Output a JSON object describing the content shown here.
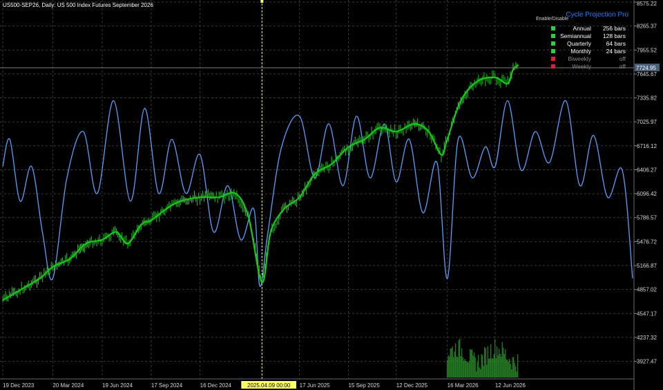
{
  "title": "US500-SEP26, Daily:  US 500 Index Futures September 2026",
  "panel": {
    "title": "Cycle Projection Pro",
    "subtitle": "Enable/Disable",
    "rows": [
      {
        "name": "Annual",
        "value": "256 bars",
        "enabled": true
      },
      {
        "name": "Semiannual",
        "value": "128 bars",
        "enabled": true
      },
      {
        "name": "Quarterly",
        "value": "64 bars",
        "enabled": true
      },
      {
        "name": "Monthly",
        "value": "24 bars",
        "enabled": true
      },
      {
        "name": "Biweekly",
        "value": "off",
        "enabled": false
      },
      {
        "name": "Weekly",
        "value": "off",
        "enabled": false
      }
    ]
  },
  "colors": {
    "background": "#000000",
    "price": "#19c819",
    "cycle": "#5aa0ff",
    "grid": "#3a3a3a",
    "marker": "#ffff66",
    "enabled": "#2ecc40",
    "disabled": "#d6204a",
    "current_price_bg": "#4a5f7a"
  },
  "chart_data": {
    "type": "line",
    "ylim": [
      3700,
      8575.22
    ],
    "y_ticks": [
      "8575.22",
      "8265.37",
      "7955.52",
      "7645.67",
      "7335.82",
      "7025.97",
      "6716.12",
      "6406.27",
      "6096.42",
      "5786.57",
      "5476.72",
      "5166.87",
      "4857.02",
      "4547.17",
      "4237.32",
      "3927.47"
    ],
    "x_ticks": [
      "19 Dec 2023",
      "20 Mar 2024",
      "19 Jun 2024",
      "17 Sep 2024",
      "16 Dec 2024",
      "2025.04.09 00:00",
      "17 Jun 2025",
      "15 Sep 2025",
      "12 Dec 2025",
      "16 Mar 2026",
      "12 Jun 2026"
    ],
    "highlighted_x": "2025.04.09 00:00",
    "current_price": "7724.95",
    "price_series": {
      "x": [
        "2023-12-19",
        "2024-01-20",
        "2024-02-25",
        "2024-03-20",
        "2024-04-20",
        "2024-05-20",
        "2024-06-19",
        "2024-07-15",
        "2024-08-05",
        "2024-08-30",
        "2024-09-17",
        "2024-10-15",
        "2024-11-10",
        "2024-12-16",
        "2025-01-20",
        "2025-02-19",
        "2025-03-15",
        "2025-04-09",
        "2025-04-25",
        "2025-05-20",
        "2025-06-17",
        "2025-07-15",
        "2025-08-15",
        "2025-09-15",
        "2025-10-15",
        "2025-11-12",
        "2025-12-12",
        "2026-01-15",
        "2026-02-10",
        "2026-03-05",
        "2026-03-16",
        "2026-04-10",
        "2026-05-10",
        "2026-06-12",
        "2026-07-05",
        "2026-07-15",
        "2026-07-25"
      ],
      "values": [
        4720,
        4850,
        5000,
        5150,
        5250,
        5450,
        5500,
        5600,
        5450,
        5700,
        5750,
        5900,
        6000,
        6050,
        6050,
        6100,
        5800,
        4950,
        5600,
        5900,
        6050,
        6350,
        6480,
        6700,
        6800,
        6950,
        6900,
        7000,
        6900,
        6600,
        6800,
        7300,
        7550,
        7600,
        7520,
        7700,
        7760
      ]
    },
    "cycle_series": {
      "x": [
        "2023-12-19",
        "2024-01-01",
        "2024-01-20",
        "2024-02-10",
        "2024-03-01",
        "2024-03-20",
        "2024-04-15",
        "2024-05-15",
        "2024-06-10",
        "2024-07-10",
        "2024-08-10",
        "2024-09-05",
        "2024-10-01",
        "2024-10-25",
        "2024-11-20",
        "2024-12-16",
        "2025-01-10",
        "2025-02-05",
        "2025-03-01",
        "2025-03-25",
        "2025-04-05",
        "2025-04-20",
        "2025-05-15",
        "2025-06-17",
        "2025-07-15",
        "2025-08-10",
        "2025-09-05",
        "2025-09-30",
        "2025-10-25",
        "2025-11-20",
        "2025-12-12",
        "2026-01-05",
        "2026-01-30",
        "2026-02-25",
        "2026-03-16",
        "2026-04-05",
        "2026-05-01",
        "2026-05-25",
        "2026-06-12",
        "2026-07-05",
        "2026-07-30",
        "2026-08-25",
        "2026-09-20",
        "2026-10-20",
        "2026-11-15",
        "2026-12-10",
        "2027-01-05",
        "2027-02-01",
        "2027-02-20"
      ],
      "values": [
        6450,
        6800,
        6000,
        6450,
        5600,
        5000,
        6300,
        6900,
        6100,
        7300,
        6000,
        7200,
        6100,
        6800,
        6100,
        6600,
        5600,
        6200,
        5500,
        5900,
        4900,
        5600,
        6700,
        7100,
        6300,
        7000,
        6200,
        7100,
        6300,
        7000,
        6250,
        6800,
        5850,
        6500,
        5000,
        6800,
        6300,
        6700,
        6450,
        7300,
        6400,
        6900,
        6500,
        7300,
        6200,
        6850,
        6050,
        6400,
        5000
      ]
    }
  }
}
